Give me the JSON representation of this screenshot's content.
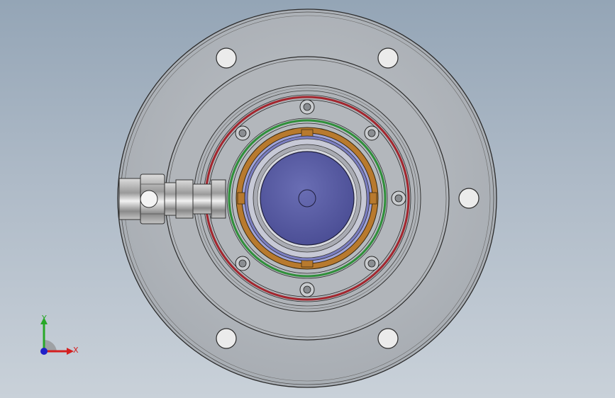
{
  "viewport": {
    "background_top": "#94a5b6",
    "background_bottom": "#c9d1d9"
  },
  "model": {
    "body_color": "#b4b8bd",
    "edge_color": "#2b2b2b",
    "ring_red": "#a3262e",
    "ring_green": "#2f8f3a",
    "ring_orange": "#b87a2e",
    "ring_blue": "#6f72b8",
    "shaft_color": "#5a5ea8"
  },
  "triad": {
    "x_label": "X",
    "y_label": "Y",
    "x_color": "#d42020",
    "y_color": "#28a828",
    "z_color": "#2020c8"
  }
}
